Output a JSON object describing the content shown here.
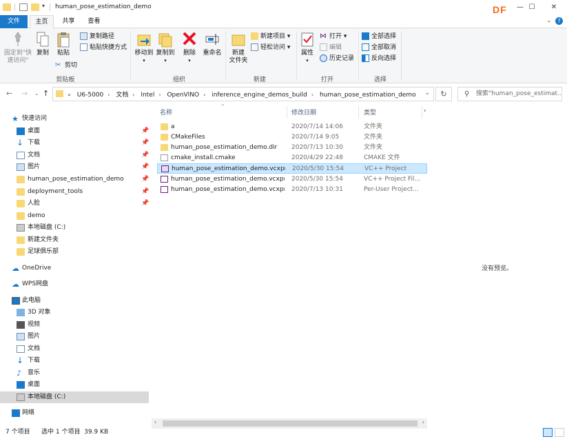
{
  "window": {
    "title": "human_pose_estimation_demo",
    "logo_text": "DF",
    "controls": {
      "minimize": "—",
      "maximize": "☐",
      "close": "✕"
    }
  },
  "ribbon_tabs": [
    "文件",
    "主页",
    "共享",
    "查看"
  ],
  "ribbon": {
    "clipboard": {
      "label": "剪贴板",
      "pin_quick": "固定到\"快\n速访问\"",
      "copy": "复制",
      "paste": "粘贴",
      "copy_path": "复制路径",
      "paste_shortcut": "粘贴快捷方式",
      "cut": "剪切"
    },
    "organize": {
      "label": "组织",
      "move_to": "移动到",
      "copy_to": "复制到",
      "delete": "删除",
      "rename": "重命名"
    },
    "new": {
      "label": "新建",
      "new_folder": "新建\n文件夹",
      "new_item": "新建项目 ▾",
      "easy_access": "轻松访问 ▾"
    },
    "open": {
      "label": "打开",
      "properties": "属性",
      "open": "打开 ▾",
      "edit": "编辑",
      "history": "历史记录"
    },
    "select": {
      "label": "选择",
      "select_all": "全部选择",
      "select_none": "全部取消",
      "invert": "反向选择"
    }
  },
  "address": {
    "crumbs": [
      "U6-5000",
      "文档",
      "Intel",
      "OpenVINO",
      "inference_engine_demos_build",
      "human_pose_estimation_demo"
    ],
    "search_placeholder": "搜索\"human_pose_estimat..."
  },
  "nav": {
    "quick_access": "快速访问",
    "items": [
      {
        "label": "桌面",
        "pinned": true
      },
      {
        "label": "下载",
        "pinned": true
      },
      {
        "label": "文档",
        "pinned": true
      },
      {
        "label": "图片",
        "pinned": true
      },
      {
        "label": "human_pose_estimation_demo",
        "pinned": true
      },
      {
        "label": "deployment_tools",
        "pinned": true
      },
      {
        "label": "人脸",
        "pinned": true
      },
      {
        "label": "demo",
        "pinned": false
      },
      {
        "label": "本地磁盘 (C:)",
        "pinned": false
      },
      {
        "label": "新建文件夹",
        "pinned": false
      },
      {
        "label": "足球俱乐部",
        "pinned": false
      }
    ],
    "onedrive": "OneDrive",
    "wps": "WPS网盘",
    "this_pc": "此电脑",
    "pc_items": [
      "3D 对象",
      "视频",
      "图片",
      "文档",
      "下载",
      "音乐",
      "桌面",
      "本地磁盘 (C:)"
    ],
    "network": "网络"
  },
  "files": {
    "headers": {
      "name": "名称",
      "date": "修改日期",
      "type": "类型"
    },
    "rows": [
      {
        "name": "a",
        "date": "2020/7/14 14:06",
        "type": "文件夹",
        "icon": "folder"
      },
      {
        "name": "CMakeFiles",
        "date": "2020/7/14 9:05",
        "type": "文件夹",
        "icon": "folder"
      },
      {
        "name": "human_pose_estimation_demo.dir",
        "date": "2020/7/13 10:30",
        "type": "文件夹",
        "icon": "folder"
      },
      {
        "name": "cmake_install.cmake",
        "date": "2020/4/29 22:48",
        "type": "CMAKE 文件",
        "icon": "file"
      },
      {
        "name": "human_pose_estimation_demo.vcxproj",
        "date": "2020/5/30 15:54",
        "type": "VC++ Project",
        "icon": "vcxproj"
      },
      {
        "name": "human_pose_estimation_demo.vcxpr...",
        "date": "2020/5/30 15:54",
        "type": "VC++ Project Fil...",
        "icon": "vcxproj"
      },
      {
        "name": "human_pose_estimation_demo.vcxpr...",
        "date": "2020/7/13 10:31",
        "type": "Per-User Project...",
        "icon": "vcxproj"
      }
    ],
    "selected_index": 4
  },
  "preview": {
    "text": "没有预览。"
  },
  "status": {
    "count": "7 个项目",
    "selection": "选中 1 个项目  39.9 KB"
  },
  "colors": {
    "accent": "#1979ca",
    "selection": "#cce8ff",
    "folder": "#f8d775",
    "logo": "#f26a1b"
  }
}
